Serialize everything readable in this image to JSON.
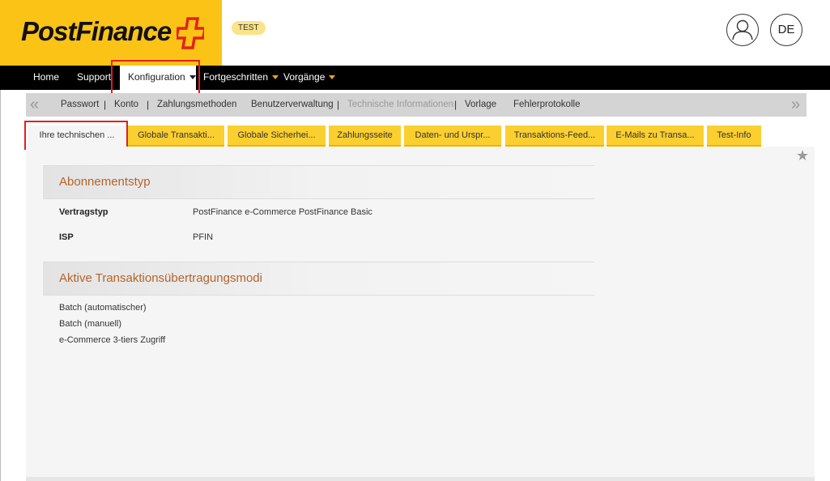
{
  "brand": {
    "name": "PostFinance",
    "env_badge": "TEST"
  },
  "header": {
    "user_icon": "user-icon",
    "language": "DE"
  },
  "topnav": [
    {
      "label": "Home"
    },
    {
      "label": "Support"
    },
    {
      "label": "Konfiguration"
    },
    {
      "label": "Fortgeschritten"
    },
    {
      "label": "Vorgänge"
    }
  ],
  "subnav": {
    "links": [
      "Passwort",
      "Konto",
      "Zahlungsmethoden",
      "Benutzerverwaltung",
      "Technische Informationen",
      "Vorlage",
      "Fehlerprotokolle"
    ],
    "separator": "|",
    "prev": "«",
    "next": "»"
  },
  "tabs": [
    "Ihre technischen ...",
    "Globale Transakti...",
    "Globale Sicherhei...",
    "Zahlungsseite",
    "Daten- und Urspr...",
    "Transaktions-Feed...",
    "E-Mails zu Transa...",
    "Test-Info"
  ],
  "section1": {
    "title": "Abonnementstyp",
    "rows": [
      {
        "label": "Vertragstyp",
        "value": "PostFinance e-Commerce PostFinance Basic"
      },
      {
        "label": "ISP",
        "value": "PFIN"
      }
    ]
  },
  "section2": {
    "title": "Aktive Transaktionsübertragungsmodi",
    "modes": [
      "Batch (automatischer)",
      "Batch (manuell)",
      "e-Commerce 3-tiers Zugriff"
    ]
  },
  "colors": {
    "brand_yellow": "#fbc316",
    "tab_yellow": "#fbcf2f",
    "highlight_red": "#e02020",
    "section_title": "#b5642a"
  }
}
